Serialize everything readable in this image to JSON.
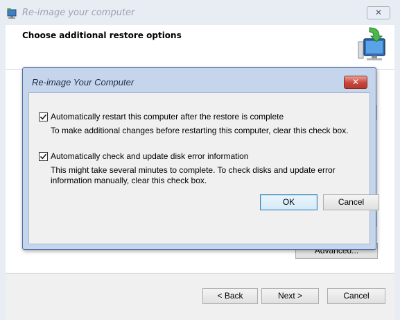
{
  "window": {
    "title": "Re-image your computer",
    "close_glyph": "✕",
    "app_icon": "computer-restore-icon"
  },
  "header": {
    "heading": "Choose additional restore options",
    "graphic_icon": "computer-restore-graphic"
  },
  "buttons": {
    "advanced": "Advanced...",
    "back": "< Back",
    "next": "Next >",
    "cancel": "Cancel"
  },
  "dialog": {
    "title": "Re-image Your Computer",
    "close_glyph": "✕",
    "options": [
      {
        "label": "Automatically restart this computer after the restore is complete",
        "description": "To make additional changes before restarting this computer, clear this check box.",
        "checked": true
      },
      {
        "label": "Automatically check and update disk error information",
        "description": "This might take several minutes to complete. To check disks and update error information manually, clear this check box.",
        "checked": true
      }
    ],
    "ok_label": "OK",
    "cancel_label": "Cancel"
  },
  "colors": {
    "dialog_frame": "#c5d6ec",
    "close_button": "#c7453a",
    "default_button_border": "#3c7fb1"
  }
}
